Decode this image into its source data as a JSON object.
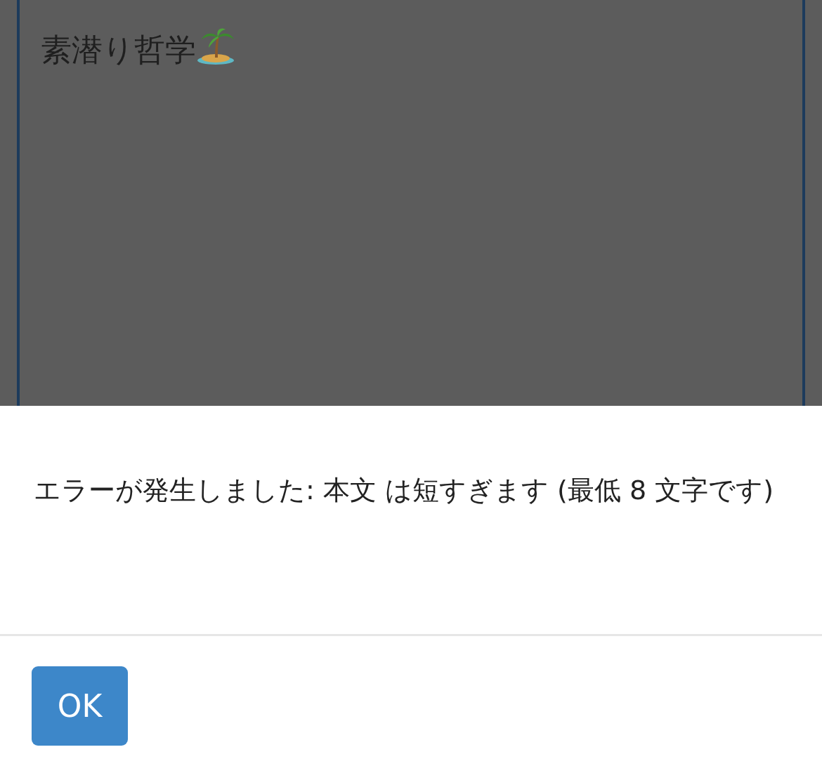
{
  "editor": {
    "value": "素潜り哲学"
  },
  "alert": {
    "message": "エラーが発生しました: 本文 は短すぎます (最低 8 文字です)",
    "buttons": [
      "OK"
    ]
  }
}
